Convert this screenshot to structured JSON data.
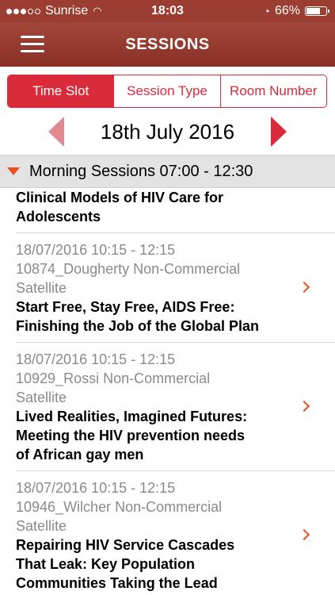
{
  "status": {
    "carrier": "Sunrise",
    "time": "18:03",
    "battery": "66%"
  },
  "nav": {
    "title": "SESSIONS"
  },
  "tabs": [
    "Time Slot",
    "Session Type",
    "Room Number"
  ],
  "date": "18th July 2016",
  "section": {
    "label": "Morning Sessions 07:00 - 12:30"
  },
  "sessions": [
    {
      "title_lines": [
        "Clinical Models of HIV Care for",
        "Adolescents"
      ]
    },
    {
      "time": "18/07/2016 10:15 - 12:15",
      "code_lines": [
        "10874_Dougherty Non-Commercial",
        "Satellite"
      ],
      "title_lines": [
        "Start Free, Stay Free, AIDS Free:",
        "Finishing the Job of the Global Plan"
      ]
    },
    {
      "time": "18/07/2016 10:15 - 12:15",
      "code_lines": [
        "10929_Rossi Non-Commercial",
        "Satellite"
      ],
      "title_lines": [
        "Lived Realities, Imagined Futures:",
        "Meeting the HIV prevention needs",
        "of African gay men"
      ]
    },
    {
      "time": "18/07/2016 10:15 - 12:15",
      "code_lines": [
        "10946_Wilcher Non-Commercial",
        "Satellite"
      ],
      "title_lines": [
        "Repairing HIV Service Cascades",
        "That Leak: Key Population",
        "Communities Taking the Lead"
      ]
    }
  ]
}
